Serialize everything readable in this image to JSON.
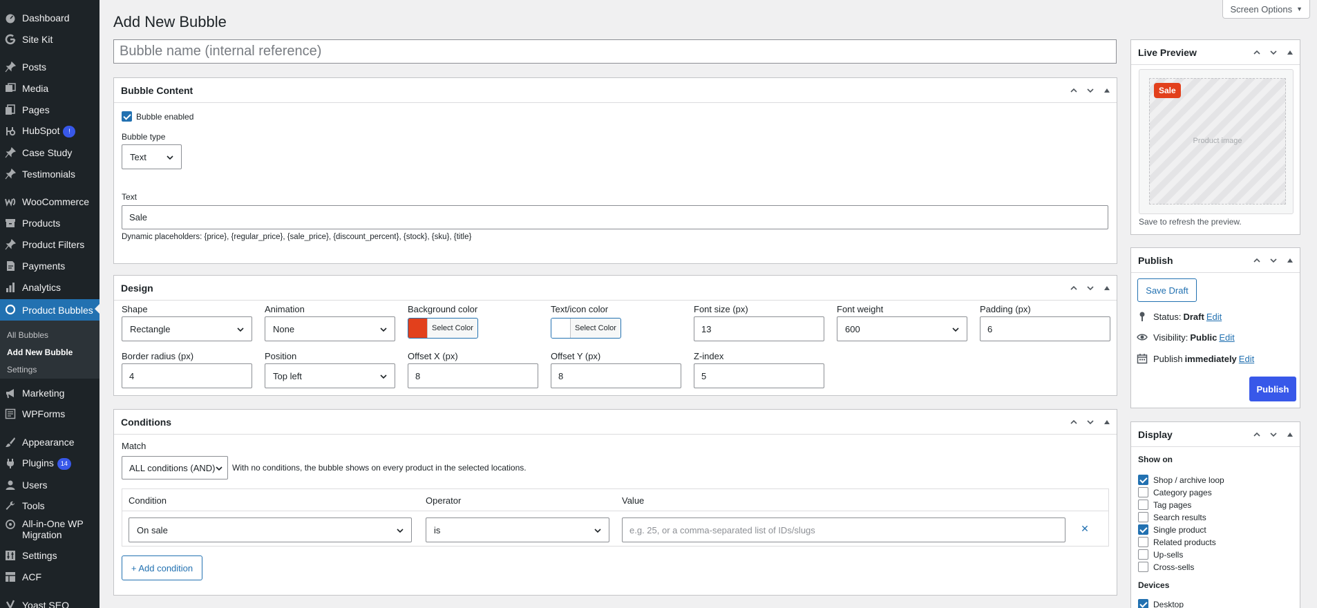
{
  "menu": {
    "items": {
      "dashboard": "Dashboard",
      "sitekit": "Site Kit",
      "posts": "Posts",
      "media": "Media",
      "pages": "Pages",
      "hubspot": "HubSpot",
      "hubspot_badge": "!",
      "casestudy": "Case Study",
      "testimonials": "Testimonials",
      "woocommerce": "WooCommerce",
      "products": "Products",
      "productfilters": "Product Filters",
      "payments": "Payments",
      "analytics": "Analytics",
      "productbubbles": "Product Bubbles",
      "marketing": "Marketing",
      "wpforms": "WPForms",
      "appearance": "Appearance",
      "plugins": "Plugins",
      "plugins_badge": "14",
      "users": "Users",
      "tools": "Tools",
      "migration": "All-in-One WP Migration",
      "settings": "Settings",
      "acf": "ACF",
      "yoast": "Yoast SEO"
    },
    "submenu": {
      "all": "All Bubbles",
      "addnew": "Add New Bubble",
      "settings": "Settings"
    }
  },
  "page": {
    "title": "Add New Bubble",
    "screen_options": "Screen Options",
    "name_placeholder": "Bubble name (internal reference)"
  },
  "content_box": {
    "title": "Bubble Content",
    "enabled_label": "Bubble enabled",
    "enabled": true,
    "type_label": "Bubble type",
    "type_value": "Text",
    "text_label": "Text",
    "text_value": "Sale",
    "placeholders_help": "Dynamic placeholders: {price}, {regular_price}, {sale_price}, {discount_percent}, {stock}, {sku}, {title}"
  },
  "design_box": {
    "title": "Design",
    "shape_label": "Shape",
    "shape_value": "Rectangle",
    "animation_label": "Animation",
    "animation_value": "None",
    "bg_label": "Background color",
    "bg_color": "#e2401c",
    "select_color": "Select Color",
    "text_color_label": "Text/icon color",
    "text_color": "#ffffff",
    "fontsize_label": "Font size (px)",
    "fontsize_value": "13",
    "fontweight_label": "Font weight",
    "fontweight_value": "600",
    "padding_label": "Padding (px)",
    "padding_value": "6",
    "radius_label": "Border radius (px)",
    "radius_value": "4",
    "position_label": "Position",
    "position_value": "Top left",
    "offx_label": "Offset X (px)",
    "offx_value": "8",
    "offy_label": "Offset Y (px)",
    "offy_value": "8",
    "zindex_label": "Z-index",
    "zindex_value": "5"
  },
  "conditions_box": {
    "title": "Conditions",
    "match_label": "Match",
    "match_value": "ALL conditions (AND)",
    "match_help": "With no conditions, the bubble shows on every product in the selected locations.",
    "col_condition": "Condition",
    "col_operator": "Operator",
    "col_value": "Value",
    "row_condition": "On sale",
    "row_operator": "is",
    "row_value_placeholder": "e.g. 25, or a comma-separated list of IDs/slugs",
    "add_condition": "+ Add condition"
  },
  "preview_box": {
    "title": "Live Preview",
    "badge_text": "Sale",
    "image_placeholder": "Product image",
    "note": "Save to refresh the preview."
  },
  "publish_box": {
    "title": "Publish",
    "save_draft": "Save Draft",
    "status_label": "Status:",
    "status_value": "Draft",
    "visibility_label": "Visibility:",
    "visibility_value": "Public",
    "publish_label": "Publish",
    "publish_value": "immediately",
    "edit": "Edit",
    "publish_button": "Publish"
  },
  "display_box": {
    "title": "Display",
    "show_on_label": "Show on",
    "options": [
      {
        "label": "Shop / archive loop",
        "checked": true
      },
      {
        "label": "Category pages",
        "checked": false
      },
      {
        "label": "Tag pages",
        "checked": false
      },
      {
        "label": "Search results",
        "checked": false
      },
      {
        "label": "Single product",
        "checked": true
      },
      {
        "label": "Related products",
        "checked": false
      },
      {
        "label": "Up-sells",
        "checked": false
      },
      {
        "label": "Cross-sells",
        "checked": false
      }
    ],
    "devices_label": "Devices",
    "devices": [
      {
        "label": "Desktop",
        "checked": true
      }
    ]
  },
  "colors": {
    "accent": "#2271b1",
    "primary_button": "#3858e9",
    "sale_badge": "#e2401c"
  }
}
